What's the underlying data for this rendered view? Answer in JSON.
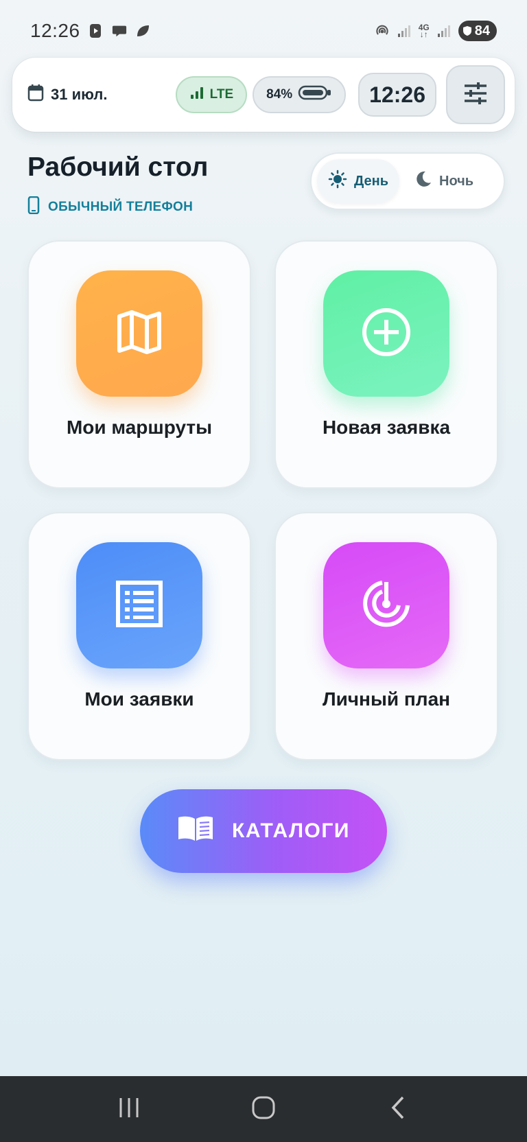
{
  "status_bar": {
    "time": "12:26",
    "network_label": "4G",
    "battery": "84"
  },
  "top_card": {
    "date": "31 июл.",
    "network": "LTE",
    "battery": "84%",
    "clock": "12:26"
  },
  "header": {
    "title": "Рабочий стол",
    "subtitle": "ОБЫЧНЫЙ ТЕЛЕФОН"
  },
  "theme_toggle": {
    "day": "День",
    "night": "Ночь",
    "selected": "day"
  },
  "tiles": [
    {
      "label": "Мои маршруты",
      "icon": "map-icon",
      "color": "#ffb04d"
    },
    {
      "label": "Новая заявка",
      "icon": "plus-circle-icon",
      "color": "#66f0ad"
    },
    {
      "label": "Мои заявки",
      "icon": "list-icon",
      "color": "#5592f8"
    },
    {
      "label": "Личный план",
      "icon": "target-icon",
      "color": "#db55f7"
    }
  ],
  "catalog_button": {
    "label": "КАТАЛОГИ",
    "icon": "book-icon"
  },
  "colors": {
    "accent_teal": "#147f9a",
    "lte_green": "#1c6b34",
    "nav_bar": "#2a2d30"
  }
}
